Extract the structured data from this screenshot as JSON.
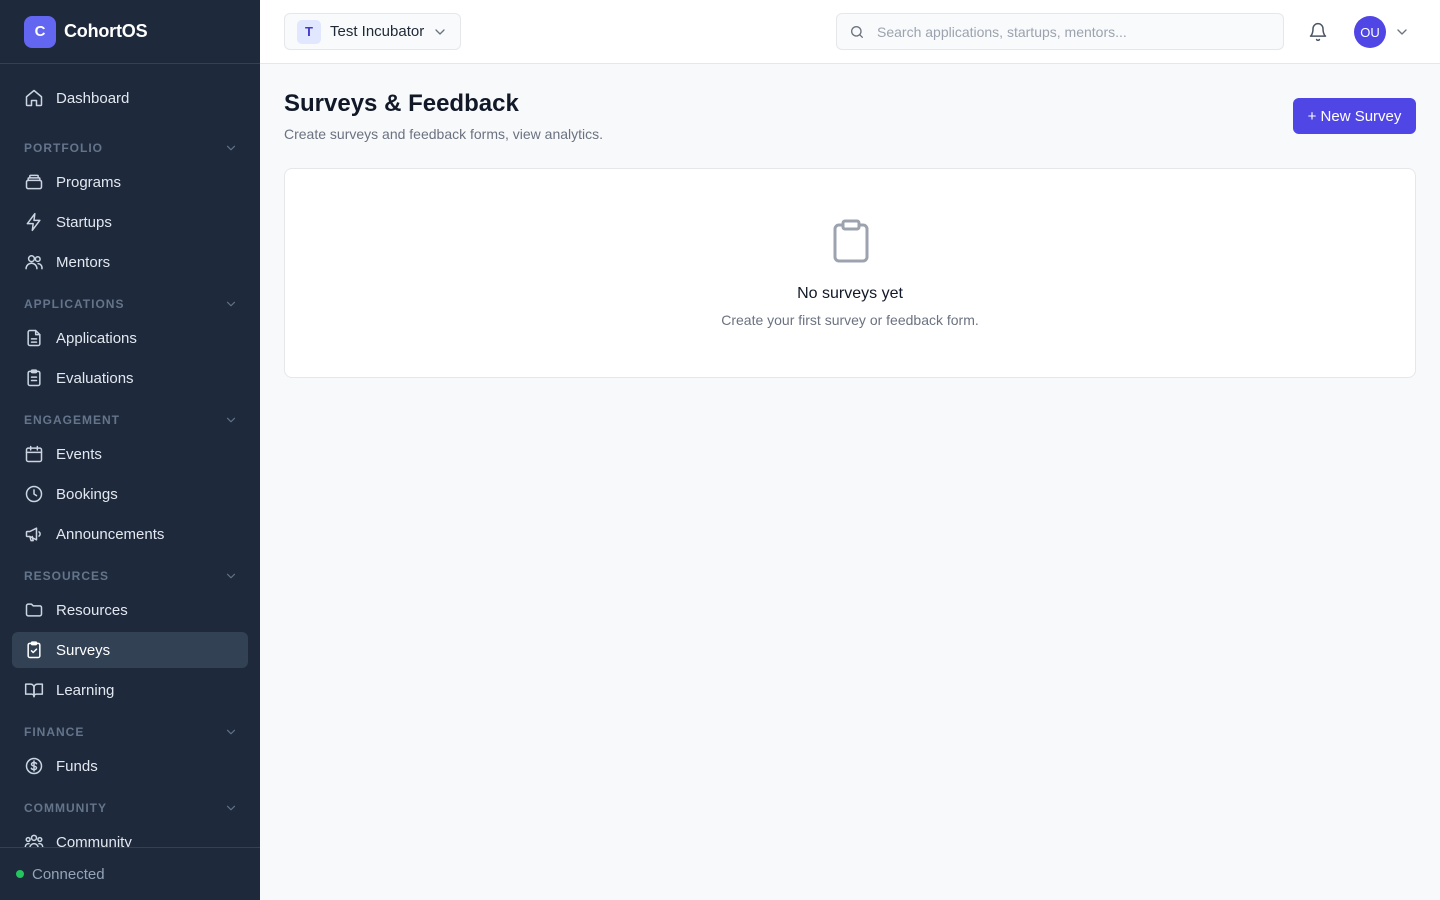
{
  "app": {
    "logo_letter": "C",
    "name": "CohortOS"
  },
  "sidebar": {
    "dashboard": "Dashboard",
    "sections": {
      "portfolio": "PORTFOLIO",
      "applications": "APPLICATIONS",
      "engagement": "ENGAGEMENT",
      "resources": "RESOURCES",
      "finance": "FINANCE",
      "community": "COMMUNITY"
    },
    "items": {
      "programs": "Programs",
      "startups": "Startups",
      "mentors": "Mentors",
      "applications": "Applications",
      "evaluations": "Evaluations",
      "events": "Events",
      "bookings": "Bookings",
      "announcements": "Announcements",
      "resources": "Resources",
      "surveys": "Surveys",
      "learning": "Learning",
      "funds": "Funds",
      "community": "Community"
    },
    "active_item": "surveys",
    "status": {
      "label": "Connected",
      "color": "#22c55e"
    }
  },
  "header": {
    "org": {
      "badge": "T",
      "name": "Test Incubator"
    },
    "search": {
      "placeholder": "Search applications, startups, mentors...",
      "value": ""
    },
    "user": {
      "initials": "OU"
    }
  },
  "main": {
    "title": "Surveys & Feedback",
    "subtitle": "Create surveys and feedback forms, view analytics.",
    "new_button": "+ New Survey",
    "empty": {
      "icon": "clipboard-icon",
      "title": "No surveys yet",
      "subtitle": "Create your first survey or feedback form."
    }
  },
  "colors": {
    "sidebar_bg": "#1e293b",
    "accent": "#4f46e5",
    "brand": "#6366f1"
  }
}
